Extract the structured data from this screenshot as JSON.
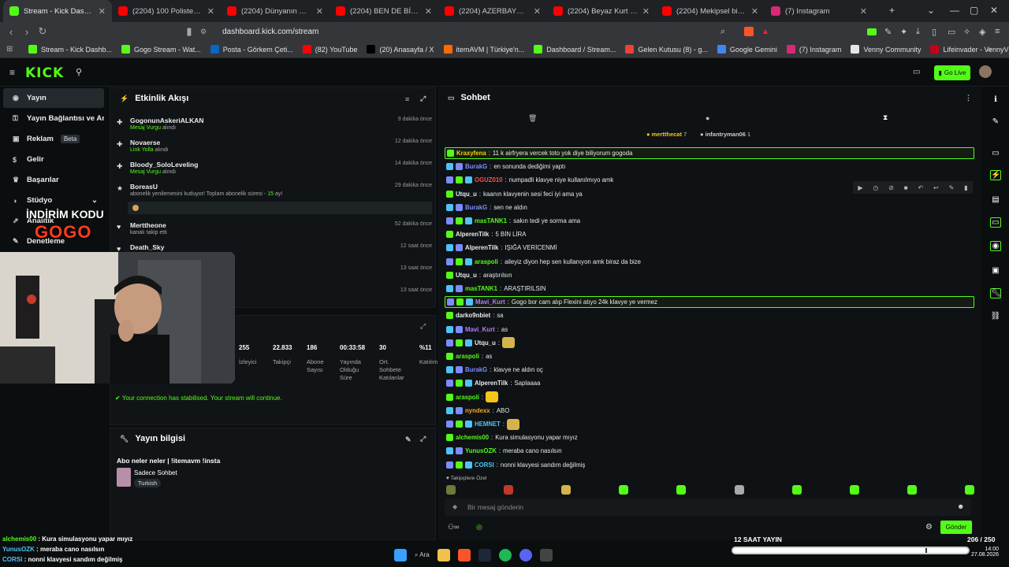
{
  "browser": {
    "tabs": [
      {
        "title": "Stream - Kick Dashboard",
        "color": "#53fc18",
        "active": true
      },
      {
        "title": "(2204) 100 Polisten Kaç, 500.00",
        "color": "#ff0000"
      },
      {
        "title": "(2204) Dünyanın En Gizli Yahu",
        "color": "#ff0000"
      },
      {
        "title": "(2204) BEN DE BİLİYORUM ÖZ",
        "color": "#ff0000"
      },
      {
        "title": "(2204) AZERBAYCAN'IN EN G",
        "color": "#ff0000"
      },
      {
        "title": "(2204) Beyaz Kurt - YouTube",
        "color": "#ff0000"
      },
      {
        "title": "(2204) Mekipsel bir şeyler 4 k",
        "color": "#ff0000"
      },
      {
        "title": "(7) Instagram",
        "color": "#d62976"
      }
    ],
    "url": "dashboard.kick.com/stream",
    "bookmarks": [
      {
        "label": "Stream - Kick Dashb...",
        "color": "#53fc18"
      },
      {
        "label": "Gogo Stream - Wat...",
        "color": "#53fc18"
      },
      {
        "label": "Posta - Görkem Çeti...",
        "color": "#0a66c2"
      },
      {
        "label": "(82) YouTube",
        "color": "#ff0000"
      },
      {
        "label": "(20) Anasayfa / X",
        "color": "#000000"
      },
      {
        "label": "itemAVM | Türkiye'n...",
        "color": "#ff6a00"
      },
      {
        "label": "Dashboard / Stream...",
        "color": "#53fc18"
      },
      {
        "label": "Gelen Kutusu (8) - g...",
        "color": "#ea4335"
      },
      {
        "label": "Google Gemini",
        "color": "#4285f4"
      },
      {
        "label": "(7) Instagram",
        "color": "#d62976"
      },
      {
        "label": "Venny Community",
        "color": "#e6e6e6"
      },
      {
        "label": "Lifeinvader - VennyV",
        "color": "#c4001a"
      }
    ]
  },
  "kick": {
    "logo": "KICK",
    "go_live": "Go Live",
    "accent": "#53fc18"
  },
  "sidebar": {
    "items": [
      {
        "label": "Yayın",
        "icon": "broadcast-icon",
        "selected": true
      },
      {
        "label": "Yayın Bağlantısı ve Anahtarı",
        "icon": "key-icon"
      },
      {
        "label": "Reklam",
        "icon": "ad-icon",
        "badge": "Beta"
      },
      {
        "label": "Gelir",
        "icon": "dollar-icon"
      },
      {
        "label": "Başarılar",
        "icon": "trophy-icon"
      },
      {
        "label": "Stüdyo",
        "icon": "studio-icon"
      },
      {
        "label": "Analitik",
        "icon": "chart-icon"
      },
      {
        "label": "Denetleme",
        "icon": "wrench-icon"
      }
    ]
  },
  "activity": {
    "title": "Etkinlik Akışı",
    "items": [
      {
        "name": "GogonunAskeriALKAN",
        "sub": "Mesaj Vurgu",
        "sub2": "alındı",
        "time": "9 dakika önce",
        "icon": "gift-icon"
      },
      {
        "name": "Novaerse",
        "sub": "Link Yolla",
        "sub2": "alındı",
        "time": "12 dakika önce",
        "icon": "gift-icon"
      },
      {
        "name": "Bloody_SoloLeveling",
        "sub": "Mesaj Vurgu",
        "sub2": "alındı",
        "time": "14 dakika önce",
        "icon": "gift-icon"
      },
      {
        "name": "BoreasU",
        "sub": "abonelik yenilemesini kutluyor! Toplam abonelik süresi -",
        "months": "15",
        "unit": "ay!",
        "time": "29 dakika önce",
        "icon": "star-icon"
      },
      {
        "name": "Merttheone",
        "sub": "kanalı takip etti",
        "time": "52 dakika önce",
        "icon": "heart-icon"
      },
      {
        "name": "Death_Sky",
        "sub": "",
        "time": "12 saat önce",
        "icon": "heart-icon"
      },
      {
        "name": "",
        "sub": "",
        "time": "13 saat önce",
        "icon": ""
      },
      {
        "name": "",
        "sub": "",
        "time": "13 saat önce",
        "icon": ""
      }
    ]
  },
  "stats": {
    "items": [
      {
        "value": "255",
        "label": "İzleyici"
      },
      {
        "value": "22.833",
        "label": "Takipçi"
      },
      {
        "value": "186",
        "label": "Abone Sayısı"
      },
      {
        "value": "00:33:58",
        "label": "Yayında Olduğu Süre"
      },
      {
        "value": "30",
        "label": "Ort. Sohbete Katılanlar"
      },
      {
        "value": "%11",
        "label": "Katılım"
      }
    ],
    "connection": "Your connection has stabilised. Your stream will continue."
  },
  "stream_info": {
    "title": "Yayın bilgisi",
    "stream_title": "Abo neler neler | !itemavm !insta",
    "category": "Sadece Sohbet",
    "tag": "Turkish"
  },
  "chat": {
    "title": "Sohbet",
    "pinned_users": [
      "mertthecat",
      "7",
      "infantryman06",
      "1"
    ],
    "messages": [
      {
        "name": "Kraxyfena",
        "color": "#f5d300",
        "text": "11 k airfryera vercek toto yok diye biliyorum gogoda",
        "highlight": true
      },
      {
        "name": "BurakG",
        "color": "#7b8cff",
        "text": "en sonunda dediğimi yaptı"
      },
      {
        "name": "OGUZ010",
        "color": "#ff4d4d",
        "text": "numpadli klavye niye kullanılmıyo amk"
      },
      {
        "name": "Utqu_u",
        "color": "#e8eaed",
        "text": "kaanın klavyenin sesi feci iyi ama ya"
      },
      {
        "name": "BurakG",
        "color": "#7b8cff",
        "text": "sen ne aldın"
      },
      {
        "name": "masTANK1",
        "color": "#53fc18",
        "text": "sakın tedi ye sorma ama"
      },
      {
        "name": "AlperenTilk",
        "color": "#e8eaed",
        "text": "5 BİN LİRA"
      },
      {
        "name": "AlperenTilk",
        "color": "#e8eaed",
        "text": "IŞIĞA VERİCENMİ"
      },
      {
        "name": "araspoli",
        "color": "#53fc18",
        "text": "aileyiz diyon hep sen kullanıyon amk biraz da bize"
      },
      {
        "name": "Utqu_u",
        "color": "#e8eaed",
        "text": "araştırılsın"
      },
      {
        "name": "masTANK1",
        "color": "#53fc18",
        "text": "ARAŞTIRILSIN"
      },
      {
        "name": "Mavi_Kurt",
        "color": "#b57bff",
        "text": "Gogo bor cam alıp Flexini atıyo 24k klavye ye vermez",
        "highlight": true
      },
      {
        "name": "darko9nbiet",
        "color": "#e8eaed",
        "text": "sa"
      },
      {
        "name": "Mavi_Kurt",
        "color": "#b57bff",
        "text": "as"
      },
      {
        "name": "Utqu_u",
        "color": "#e8eaed",
        "text": ""
      },
      {
        "name": "araspoli",
        "color": "#53fc18",
        "text": "as"
      },
      {
        "name": "BurakG",
        "color": "#7b8cff",
        "text": "klavye ne aldın oç"
      },
      {
        "name": "AlperenTilk",
        "color": "#e8eaed",
        "text": "Saplaaaa"
      },
      {
        "name": "araspoli",
        "color": "#53fc18",
        "text": ""
      },
      {
        "name": "nyndexx",
        "color": "#f5a623",
        "text": "ABO"
      },
      {
        "name": "HEMNET",
        "color": "#4fc3f7",
        "text": ""
      },
      {
        "name": "alchemis00",
        "color": "#53fc18",
        "text": "Kura simulasyonu yapar mıyız"
      },
      {
        "name": "YunusOZK",
        "color": "#53fc18",
        "text": "meraba cano nasılsın"
      },
      {
        "name": "CORSI",
        "color": "#4fc3f7",
        "text": "nonni klavyesi sandım değilmiş"
      }
    ],
    "followers_only": "Takipçilere Özel",
    "input_placeholder": "Bir mesaj gönderin",
    "send": "Gönder"
  },
  "overlay": {
    "promo_line1": "İNDİRİM KODU",
    "promo_line2": "GOGO",
    "bottom_chat": [
      {
        "name": "alchemis00",
        "color": "#53fc18",
        "text": "Kura simulasyonu yapar mıyız"
      },
      {
        "name": "YunusOZK",
        "color": "#4fc3f7",
        "text": "meraba cano nasılsın"
      },
      {
        "name": "CORSI",
        "color": "#4fc3f7",
        "text": "nonni klavyesi sandım değilmiş"
      }
    ],
    "stream_label": "12 SAAT YAYIN",
    "progress": "206 / 250",
    "progress_value": 206,
    "progress_max": 250,
    "clock_time": "14:00",
    "clock_date": "27.08.2026"
  }
}
